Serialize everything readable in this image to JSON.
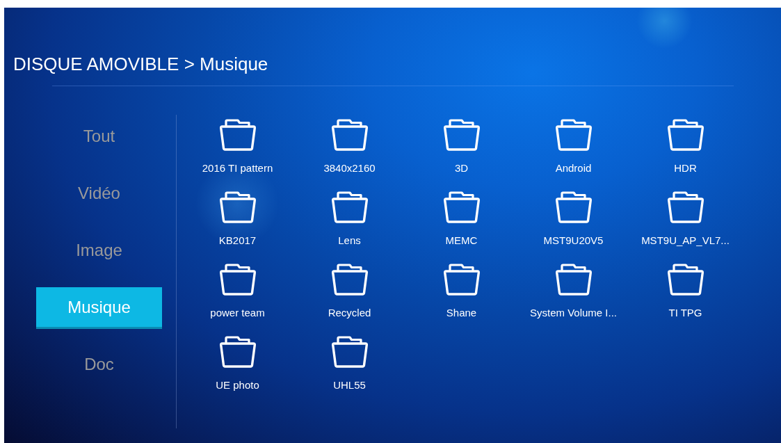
{
  "breadcrumb": "DISQUE AMOVIBLE > Musique",
  "sidebar": {
    "items": [
      {
        "label": "Tout",
        "selected": false
      },
      {
        "label": "Vidéo",
        "selected": false
      },
      {
        "label": "Image",
        "selected": false
      },
      {
        "label": "Musique",
        "selected": true
      },
      {
        "label": "Doc",
        "selected": false
      }
    ]
  },
  "folders": [
    {
      "name": "2016 TI pattern"
    },
    {
      "name": "3840x2160"
    },
    {
      "name": "3D"
    },
    {
      "name": "Android"
    },
    {
      "name": "HDR"
    },
    {
      "name": "KB2017"
    },
    {
      "name": "Lens"
    },
    {
      "name": "MEMC"
    },
    {
      "name": "MST9U20V5"
    },
    {
      "name": "MST9U_AP_VL7..."
    },
    {
      "name": "power team"
    },
    {
      "name": "Recycled"
    },
    {
      "name": "Shane"
    },
    {
      "name": "System Volume I..."
    },
    {
      "name": "TI TPG"
    },
    {
      "name": "UE photo"
    },
    {
      "name": "UHL55"
    }
  ]
}
